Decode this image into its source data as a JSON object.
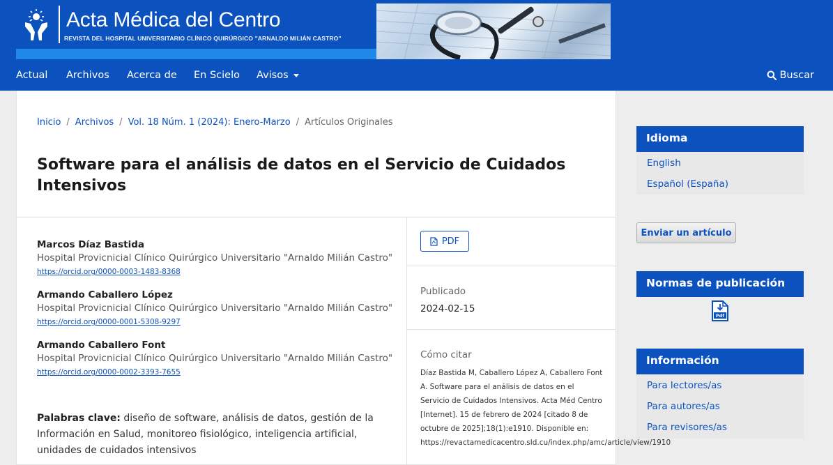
{
  "header": {
    "brand_title": "Acta Médica del Centro",
    "brand_subtitle": "REVISTA DEL HOSPITAL UNIVERSITARIO CLÍNICO QUIRÚRGICO \"ARNALDO MILIÁN CASTRO\"",
    "nav": {
      "items": [
        "Actual",
        "Archivos",
        "Acerca de",
        "En Scielo",
        "Avisos"
      ],
      "search_label": "Buscar"
    },
    "colors": {
      "primary": "#0b52bf",
      "accent_strip": "#1f88e8"
    }
  },
  "breadcrumb": {
    "home": "Inicio",
    "archives": "Archivos",
    "issue": "Vol. 18 Núm. 1 (2024): Enero-Marzo",
    "section": "Artículos Originales"
  },
  "article": {
    "title": "Software para el análisis de datos en el Servicio de Cuidados Intensivos",
    "authors": [
      {
        "name": "Marcos Díaz Bastida",
        "affiliation": "Hospital Provicnicial Clínico Quirúrgico Universitario \"Arnaldo Milián Castro\"",
        "orcid": "https://orcid.org/0000-0003-1483-8368"
      },
      {
        "name": "Armando Caballero López",
        "affiliation": "Hospital Provicnicial Clínico Quirúrgico Universitario \"Arnaldo Milián Castro\"",
        "orcid": "https://orcid.org/0000-0001-5308-9297"
      },
      {
        "name": "Armando Caballero Font",
        "affiliation": "Hospital Provicnicial Clínico Quirúrgico Universitario \"Arnaldo Milián Castro\"",
        "orcid": "https://orcid.org/0000-0002-3393-7655"
      }
    ],
    "keywords_label": "Palabras clave:",
    "keywords": "diseño de software, análisis de datos, gestión de la Información en Salud, monitoreo fisiológico, inteligencia artificial, unidades de cuidados intensivos",
    "pdf_label": "PDF",
    "published_label": "Publicado",
    "published_date": "2024-02-15",
    "cite_label": "Cómo citar",
    "cite_text": "Díaz Bastida M, Caballero López A, Caballero Font A. Software para el análisis de datos en el Servicio de Cuidados Intensivos. Acta Méd Centro [Internet]. 15 de febrero de 2024 [citado 8 de octubre de 2025];18(1):e1910. Disponible en: https://revactamedicacentro.sld.cu/index.php/amc/article/view/1910"
  },
  "sidebar": {
    "language": {
      "title": "Idioma",
      "links": [
        "English",
        "Español (España)"
      ]
    },
    "submit_button": "Enviar un artículo",
    "norms": {
      "title": "Normas de publicación",
      "icon": "pdf-document-icon"
    },
    "info": {
      "title": "Información",
      "links": [
        "Para lectores/as",
        "Para autores/as",
        "Para revisores/as"
      ]
    }
  }
}
